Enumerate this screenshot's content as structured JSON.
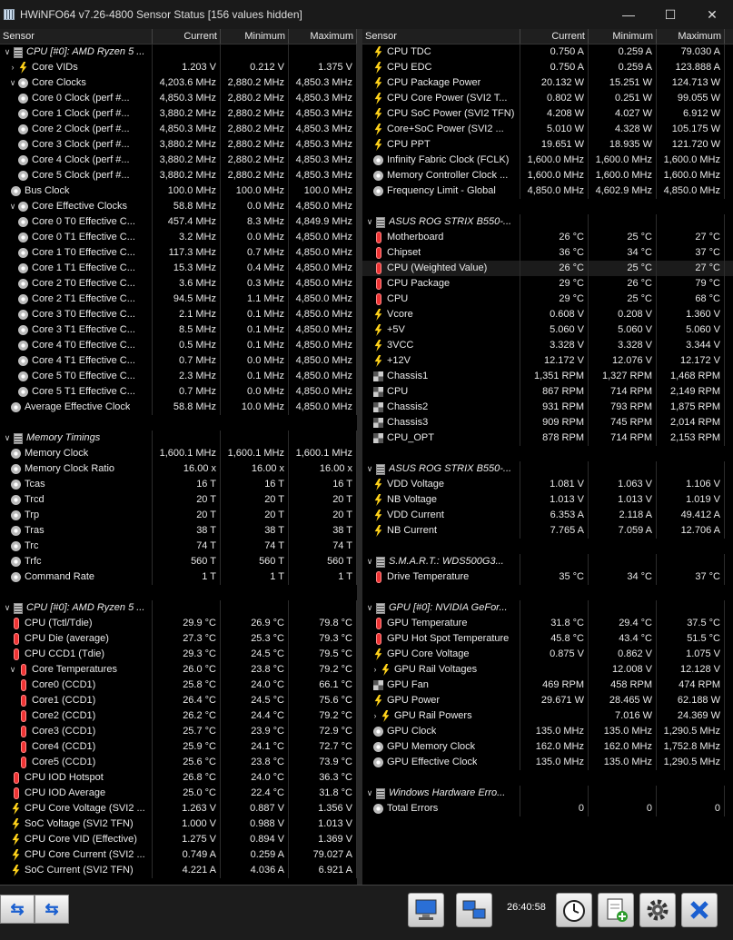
{
  "window": {
    "title": "HWiNFO64 v7.26-4800 Sensor Status [156 values hidden]",
    "min": "—",
    "max": "☐",
    "close": "✕"
  },
  "columns": {
    "sensor": "Sensor",
    "current": "Current",
    "minimum": "Minimum",
    "maximum": "Maximum"
  },
  "left_rows": [
    {
      "t": "grp",
      "exp": "∨",
      "ic": "chip",
      "n": "CPU [#0]: AMD Ryzen 5 ...",
      "c": "",
      "mn": "",
      "mx": ""
    },
    {
      "t": "r",
      "ind": 1,
      "exp": "›",
      "ic": "bolt",
      "n": "Core VIDs",
      "c": "1.203 V",
      "mn": "0.212 V",
      "mx": "1.375 V"
    },
    {
      "t": "r",
      "ind": 1,
      "exp": "∨",
      "ic": "clock",
      "n": "Core Clocks",
      "c": "4,203.6 MHz",
      "mn": "2,880.2 MHz",
      "mx": "4,850.3 MHz"
    },
    {
      "t": "r",
      "ind": 2,
      "ic": "clock",
      "n": "Core 0 Clock (perf #...",
      "c": "4,850.3 MHz",
      "mn": "2,880.2 MHz",
      "mx": "4,850.3 MHz"
    },
    {
      "t": "r",
      "ind": 2,
      "ic": "clock",
      "n": "Core 1 Clock (perf #...",
      "c": "3,880.2 MHz",
      "mn": "2,880.2 MHz",
      "mx": "4,850.3 MHz"
    },
    {
      "t": "r",
      "ind": 2,
      "ic": "clock",
      "n": "Core 2 Clock (perf #...",
      "c": "4,850.3 MHz",
      "mn": "2,880.2 MHz",
      "mx": "4,850.3 MHz"
    },
    {
      "t": "r",
      "ind": 2,
      "ic": "clock",
      "n": "Core 3 Clock (perf #...",
      "c": "3,880.2 MHz",
      "mn": "2,880.2 MHz",
      "mx": "4,850.3 MHz"
    },
    {
      "t": "r",
      "ind": 2,
      "ic": "clock",
      "n": "Core 4 Clock (perf #...",
      "c": "3,880.2 MHz",
      "mn": "2,880.2 MHz",
      "mx": "4,850.3 MHz"
    },
    {
      "t": "r",
      "ind": 2,
      "ic": "clock",
      "n": "Core 5 Clock (perf #...",
      "c": "3,880.2 MHz",
      "mn": "2,880.2 MHz",
      "mx": "4,850.3 MHz"
    },
    {
      "t": "r",
      "ind": 0,
      "ic": "clock",
      "n": "Bus Clock",
      "c": "100.0 MHz",
      "mn": "100.0 MHz",
      "mx": "100.0 MHz"
    },
    {
      "t": "r",
      "ind": 1,
      "exp": "∨",
      "ic": "clock",
      "n": "Core Effective Clocks",
      "c": "58.8 MHz",
      "mn": "0.0 MHz",
      "mx": "4,850.0 MHz"
    },
    {
      "t": "r",
      "ind": 2,
      "ic": "clock",
      "n": "Core 0 T0 Effective C...",
      "c": "457.4 MHz",
      "mn": "8.3 MHz",
      "mx": "4,849.9 MHz"
    },
    {
      "t": "r",
      "ind": 2,
      "ic": "clock",
      "n": "Core 0 T1 Effective C...",
      "c": "3.2 MHz",
      "mn": "0.0 MHz",
      "mx": "4,850.0 MHz"
    },
    {
      "t": "r",
      "ind": 2,
      "ic": "clock",
      "n": "Core 1 T0 Effective C...",
      "c": "117.3 MHz",
      "mn": "0.7 MHz",
      "mx": "4,850.0 MHz"
    },
    {
      "t": "r",
      "ind": 2,
      "ic": "clock",
      "n": "Core 1 T1 Effective C...",
      "c": "15.3 MHz",
      "mn": "0.4 MHz",
      "mx": "4,850.0 MHz"
    },
    {
      "t": "r",
      "ind": 2,
      "ic": "clock",
      "n": "Core 2 T0 Effective C...",
      "c": "3.6 MHz",
      "mn": "0.3 MHz",
      "mx": "4,850.0 MHz"
    },
    {
      "t": "r",
      "ind": 2,
      "ic": "clock",
      "n": "Core 2 T1 Effective C...",
      "c": "94.5 MHz",
      "mn": "1.1 MHz",
      "mx": "4,850.0 MHz"
    },
    {
      "t": "r",
      "ind": 2,
      "ic": "clock",
      "n": "Core 3 T0 Effective C...",
      "c": "2.1 MHz",
      "mn": "0.1 MHz",
      "mx": "4,850.0 MHz"
    },
    {
      "t": "r",
      "ind": 2,
      "ic": "clock",
      "n": "Core 3 T1 Effective C...",
      "c": "8.5 MHz",
      "mn": "0.1 MHz",
      "mx": "4,850.0 MHz"
    },
    {
      "t": "r",
      "ind": 2,
      "ic": "clock",
      "n": "Core 4 T0 Effective C...",
      "c": "0.5 MHz",
      "mn": "0.1 MHz",
      "mx": "4,850.0 MHz"
    },
    {
      "t": "r",
      "ind": 2,
      "ic": "clock",
      "n": "Core 4 T1 Effective C...",
      "c": "0.7 MHz",
      "mn": "0.0 MHz",
      "mx": "4,850.0 MHz"
    },
    {
      "t": "r",
      "ind": 2,
      "ic": "clock",
      "n": "Core 5 T0 Effective C...",
      "c": "2.3 MHz",
      "mn": "0.1 MHz",
      "mx": "4,850.0 MHz"
    },
    {
      "t": "r",
      "ind": 2,
      "ic": "clock",
      "n": "Core 5 T1 Effective C...",
      "c": "0.7 MHz",
      "mn": "0.0 MHz",
      "mx": "4,850.0 MHz"
    },
    {
      "t": "r",
      "ind": 0,
      "ic": "clock",
      "n": "Average Effective Clock",
      "c": "58.8 MHz",
      "mn": "10.0 MHz",
      "mx": "4,850.0 MHz"
    },
    {
      "t": "sep"
    },
    {
      "t": "grp",
      "exp": "∨",
      "ic": "chip",
      "n": "Memory Timings",
      "c": "",
      "mn": "",
      "mx": ""
    },
    {
      "t": "r",
      "ind": 0,
      "ic": "clock",
      "n": "Memory Clock",
      "c": "1,600.1 MHz",
      "mn": "1,600.1 MHz",
      "mx": "1,600.1 MHz"
    },
    {
      "t": "r",
      "ind": 0,
      "ic": "clock",
      "n": "Memory Clock Ratio",
      "c": "16.00 x",
      "mn": "16.00 x",
      "mx": "16.00 x"
    },
    {
      "t": "r",
      "ind": 0,
      "ic": "clock",
      "n": "Tcas",
      "c": "16 T",
      "mn": "16 T",
      "mx": "16 T"
    },
    {
      "t": "r",
      "ind": 0,
      "ic": "clock",
      "n": "Trcd",
      "c": "20 T",
      "mn": "20 T",
      "mx": "20 T"
    },
    {
      "t": "r",
      "ind": 0,
      "ic": "clock",
      "n": "Trp",
      "c": "20 T",
      "mn": "20 T",
      "mx": "20 T"
    },
    {
      "t": "r",
      "ind": 0,
      "ic": "clock",
      "n": "Tras",
      "c": "38 T",
      "mn": "38 T",
      "mx": "38 T"
    },
    {
      "t": "r",
      "ind": 0,
      "ic": "clock",
      "n": "Trc",
      "c": "74 T",
      "mn": "74 T",
      "mx": "74 T"
    },
    {
      "t": "r",
      "ind": 0,
      "ic": "clock",
      "n": "Trfc",
      "c": "560 T",
      "mn": "560 T",
      "mx": "560 T"
    },
    {
      "t": "r",
      "ind": 0,
      "ic": "clock",
      "n": "Command Rate",
      "c": "1 T",
      "mn": "1 T",
      "mx": "1 T"
    },
    {
      "t": "sep"
    },
    {
      "t": "grp",
      "exp": "∨",
      "ic": "chip",
      "n": "CPU [#0]: AMD Ryzen 5 ...",
      "c": "",
      "mn": "",
      "mx": ""
    },
    {
      "t": "r",
      "ind": 0,
      "ic": "therm",
      "n": "CPU (Tctl/Tdie)",
      "c": "29.9 °C",
      "mn": "26.9 °C",
      "mx": "79.8 °C"
    },
    {
      "t": "r",
      "ind": 0,
      "ic": "therm",
      "n": "CPU Die (average)",
      "c": "27.3 °C",
      "mn": "25.3 °C",
      "mx": "79.3 °C"
    },
    {
      "t": "r",
      "ind": 0,
      "ic": "therm",
      "n": "CPU CCD1 (Tdie)",
      "c": "29.3 °C",
      "mn": "24.5 °C",
      "mx": "79.5 °C"
    },
    {
      "t": "r",
      "ind": 1,
      "exp": "∨",
      "ic": "therm",
      "n": "Core Temperatures",
      "c": "26.0 °C",
      "mn": "23.8 °C",
      "mx": "79.2 °C"
    },
    {
      "t": "r",
      "ind": 2,
      "ic": "therm",
      "n": "Core0 (CCD1)",
      "c": "25.8 °C",
      "mn": "24.0 °C",
      "mx": "66.1 °C"
    },
    {
      "t": "r",
      "ind": 2,
      "ic": "therm",
      "n": "Core1 (CCD1)",
      "c": "26.4 °C",
      "mn": "24.5 °C",
      "mx": "75.6 °C"
    },
    {
      "t": "r",
      "ind": 2,
      "ic": "therm",
      "n": "Core2 (CCD1)",
      "c": "26.2 °C",
      "mn": "24.4 °C",
      "mx": "79.2 °C"
    },
    {
      "t": "r",
      "ind": 2,
      "ic": "therm",
      "n": "Core3 (CCD1)",
      "c": "25.7 °C",
      "mn": "23.9 °C",
      "mx": "72.9 °C"
    },
    {
      "t": "r",
      "ind": 2,
      "ic": "therm",
      "n": "Core4 (CCD1)",
      "c": "25.9 °C",
      "mn": "24.1 °C",
      "mx": "72.7 °C"
    },
    {
      "t": "r",
      "ind": 2,
      "ic": "therm",
      "n": "Core5 (CCD1)",
      "c": "25.6 °C",
      "mn": "23.8 °C",
      "mx": "73.9 °C"
    },
    {
      "t": "r",
      "ind": 0,
      "ic": "therm",
      "n": "CPU IOD Hotspot",
      "c": "26.8 °C",
      "mn": "24.0 °C",
      "mx": "36.3 °C"
    },
    {
      "t": "r",
      "ind": 0,
      "ic": "therm",
      "n": "CPU IOD Average",
      "c": "25.0 °C",
      "mn": "22.4 °C",
      "mx": "31.8 °C"
    },
    {
      "t": "r",
      "ind": 0,
      "ic": "bolt",
      "n": "CPU Core Voltage (SVI2 ...",
      "c": "1.263 V",
      "mn": "0.887 V",
      "mx": "1.356 V"
    },
    {
      "t": "r",
      "ind": 0,
      "ic": "bolt",
      "n": "SoC Voltage (SVI2 TFN)",
      "c": "1.000 V",
      "mn": "0.988 V",
      "mx": "1.013 V"
    },
    {
      "t": "r",
      "ind": 0,
      "ic": "bolt",
      "n": "CPU Core VID (Effective)",
      "c": "1.275 V",
      "mn": "0.894 V",
      "mx": "1.369 V"
    },
    {
      "t": "r",
      "ind": 0,
      "ic": "bolt",
      "n": "CPU Core Current (SVI2 ...",
      "c": "0.749 A",
      "mn": "0.259 A",
      "mx": "79.027 A"
    },
    {
      "t": "r",
      "ind": 0,
      "ic": "bolt",
      "n": "SoC Current (SVI2 TFN)",
      "c": "4.221 A",
      "mn": "4.036 A",
      "mx": "6.921 A"
    }
  ],
  "right_rows": [
    {
      "t": "r",
      "ind": 0,
      "ic": "bolt",
      "n": "CPU TDC",
      "c": "0.750 A",
      "mn": "0.259 A",
      "mx": "79.030 A"
    },
    {
      "t": "r",
      "ind": 0,
      "ic": "bolt",
      "n": "CPU EDC",
      "c": "0.750 A",
      "mn": "0.259 A",
      "mx": "123.888 A"
    },
    {
      "t": "r",
      "ind": 0,
      "ic": "bolt",
      "n": "CPU Package Power",
      "c": "20.132 W",
      "mn": "15.251 W",
      "mx": "124.713 W"
    },
    {
      "t": "r",
      "ind": 0,
      "ic": "bolt",
      "n": "CPU Core Power (SVI2 T...",
      "c": "0.802 W",
      "mn": "0.251 W",
      "mx": "99.055 W"
    },
    {
      "t": "r",
      "ind": 0,
      "ic": "bolt",
      "n": "CPU SoC Power (SVI2 TFN)",
      "c": "4.208 W",
      "mn": "4.027 W",
      "mx": "6.912 W"
    },
    {
      "t": "r",
      "ind": 0,
      "ic": "bolt",
      "n": "Core+SoC Power (SVI2 ...",
      "c": "5.010 W",
      "mn": "4.328 W",
      "mx": "105.175 W"
    },
    {
      "t": "r",
      "ind": 0,
      "ic": "bolt",
      "n": "CPU PPT",
      "c": "19.651 W",
      "mn": "18.935 W",
      "mx": "121.720 W"
    },
    {
      "t": "r",
      "ind": 0,
      "ic": "clock",
      "n": "Infinity Fabric Clock (FCLK)",
      "c": "1,600.0 MHz",
      "mn": "1,600.0 MHz",
      "mx": "1,600.0 MHz"
    },
    {
      "t": "r",
      "ind": 0,
      "ic": "clock",
      "n": "Memory Controller Clock ...",
      "c": "1,600.0 MHz",
      "mn": "1,600.0 MHz",
      "mx": "1,600.0 MHz"
    },
    {
      "t": "r",
      "ind": 0,
      "ic": "clock",
      "n": "Frequency Limit - Global",
      "c": "4,850.0 MHz",
      "mn": "4,602.9 MHz",
      "mx": "4,850.0 MHz"
    },
    {
      "t": "sep"
    },
    {
      "t": "grp",
      "exp": "∨",
      "ic": "chip",
      "n": "ASUS ROG STRIX B550-...",
      "c": "",
      "mn": "",
      "mx": ""
    },
    {
      "t": "r",
      "ind": 0,
      "ic": "therm",
      "n": "Motherboard",
      "c": "26 °C",
      "mn": "25 °C",
      "mx": "27 °C"
    },
    {
      "t": "r",
      "ind": 0,
      "ic": "therm",
      "n": "Chipset",
      "c": "36 °C",
      "mn": "34 °C",
      "mx": "37 °C"
    },
    {
      "t": "r",
      "ind": 0,
      "ic": "therm",
      "n": "CPU (Weighted Value)",
      "c": "26 °C",
      "mn": "25 °C",
      "mx": "27 °C",
      "hl": true
    },
    {
      "t": "r",
      "ind": 0,
      "ic": "therm",
      "n": "CPU Package",
      "c": "29 °C",
      "mn": "26 °C",
      "mx": "79 °C"
    },
    {
      "t": "r",
      "ind": 0,
      "ic": "therm",
      "n": "CPU",
      "c": "29 °C",
      "mn": "25 °C",
      "mx": "68 °C"
    },
    {
      "t": "r",
      "ind": 0,
      "ic": "bolt",
      "n": "Vcore",
      "c": "0.608 V",
      "mn": "0.208 V",
      "mx": "1.360 V"
    },
    {
      "t": "r",
      "ind": 0,
      "ic": "bolt",
      "n": "+5V",
      "c": "5.060 V",
      "mn": "5.060 V",
      "mx": "5.060 V"
    },
    {
      "t": "r",
      "ind": 0,
      "ic": "bolt",
      "n": "3VCC",
      "c": "3.328 V",
      "mn": "3.328 V",
      "mx": "3.344 V"
    },
    {
      "t": "r",
      "ind": 0,
      "ic": "bolt",
      "n": "+12V",
      "c": "12.172 V",
      "mn": "12.076 V",
      "mx": "12.172 V"
    },
    {
      "t": "r",
      "ind": 0,
      "ic": "fan",
      "n": "Chassis1",
      "c": "1,351 RPM",
      "mn": "1,327 RPM",
      "mx": "1,468 RPM"
    },
    {
      "t": "r",
      "ind": 0,
      "ic": "fan",
      "n": "CPU",
      "c": "867 RPM",
      "mn": "714 RPM",
      "mx": "2,149 RPM"
    },
    {
      "t": "r",
      "ind": 0,
      "ic": "fan",
      "n": "Chassis2",
      "c": "931 RPM",
      "mn": "793 RPM",
      "mx": "1,875 RPM"
    },
    {
      "t": "r",
      "ind": 0,
      "ic": "fan",
      "n": "Chassis3",
      "c": "909 RPM",
      "mn": "745 RPM",
      "mx": "2,014 RPM"
    },
    {
      "t": "r",
      "ind": 0,
      "ic": "fan",
      "n": "CPU_OPT",
      "c": "878 RPM",
      "mn": "714 RPM",
      "mx": "2,153 RPM"
    },
    {
      "t": "sep"
    },
    {
      "t": "grp",
      "exp": "∨",
      "ic": "chip",
      "n": "ASUS ROG STRIX B550-...",
      "c": "",
      "mn": "",
      "mx": ""
    },
    {
      "t": "r",
      "ind": 0,
      "ic": "bolt",
      "n": "VDD Voltage",
      "c": "1.081 V",
      "mn": "1.063 V",
      "mx": "1.106 V"
    },
    {
      "t": "r",
      "ind": 0,
      "ic": "bolt",
      "n": "NB Voltage",
      "c": "1.013 V",
      "mn": "1.013 V",
      "mx": "1.019 V"
    },
    {
      "t": "r",
      "ind": 0,
      "ic": "bolt",
      "n": "VDD Current",
      "c": "6.353 A",
      "mn": "2.118 A",
      "mx": "49.412 A"
    },
    {
      "t": "r",
      "ind": 0,
      "ic": "bolt",
      "n": "NB Current",
      "c": "7.765 A",
      "mn": "7.059 A",
      "mx": "12.706 A"
    },
    {
      "t": "sep"
    },
    {
      "t": "grp",
      "exp": "∨",
      "ic": "chip",
      "n": "S.M.A.R.T.: WDS500G3...",
      "c": "",
      "mn": "",
      "mx": ""
    },
    {
      "t": "r",
      "ind": 0,
      "ic": "therm",
      "n": "Drive Temperature",
      "c": "35 °C",
      "mn": "34 °C",
      "mx": "37 °C"
    },
    {
      "t": "sep"
    },
    {
      "t": "grp",
      "exp": "∨",
      "ic": "chip",
      "n": "GPU [#0]: NVIDIA GeFor...",
      "c": "",
      "mn": "",
      "mx": ""
    },
    {
      "t": "r",
      "ind": 0,
      "ic": "therm",
      "n": "GPU Temperature",
      "c": "31.8 °C",
      "mn": "29.4 °C",
      "mx": "37.5 °C"
    },
    {
      "t": "r",
      "ind": 0,
      "ic": "therm",
      "n": "GPU Hot Spot Temperature",
      "c": "45.8 °C",
      "mn": "43.4 °C",
      "mx": "51.5 °C"
    },
    {
      "t": "r",
      "ind": 0,
      "ic": "bolt",
      "n": "GPU Core Voltage",
      "c": "0.875 V",
      "mn": "0.862 V",
      "mx": "1.075 V"
    },
    {
      "t": "r",
      "ind": 1,
      "exp": "›",
      "ic": "bolt",
      "n": "GPU Rail Voltages",
      "c": "",
      "mn": "12.008 V",
      "mx": "12.128 V"
    },
    {
      "t": "r",
      "ind": 0,
      "ic": "fan",
      "n": "GPU Fan",
      "c": "469 RPM",
      "mn": "458 RPM",
      "mx": "474 RPM"
    },
    {
      "t": "r",
      "ind": 0,
      "ic": "bolt",
      "n": "GPU Power",
      "c": "29.671 W",
      "mn": "28.465 W",
      "mx": "62.188 W"
    },
    {
      "t": "r",
      "ind": 1,
      "exp": "›",
      "ic": "bolt",
      "n": "GPU Rail Powers",
      "c": "",
      "mn": "7.016 W",
      "mx": "24.369 W"
    },
    {
      "t": "r",
      "ind": 0,
      "ic": "clock",
      "n": "GPU Clock",
      "c": "135.0 MHz",
      "mn": "135.0 MHz",
      "mx": "1,290.5 MHz"
    },
    {
      "t": "r",
      "ind": 0,
      "ic": "clock",
      "n": "GPU Memory Clock",
      "c": "162.0 MHz",
      "mn": "162.0 MHz",
      "mx": "1,752.8 MHz"
    },
    {
      "t": "r",
      "ind": 0,
      "ic": "clock",
      "n": "GPU Effective Clock",
      "c": "135.0 MHz",
      "mn": "135.0 MHz",
      "mx": "1,290.5 MHz"
    },
    {
      "t": "sep"
    },
    {
      "t": "grp",
      "exp": "∨",
      "ic": "chip",
      "n": "Windows Hardware Erro...",
      "c": "",
      "mn": "",
      "mx": ""
    },
    {
      "t": "r",
      "ind": 0,
      "ic": "clock",
      "n": "Total Errors",
      "c": "0",
      "mn": "0",
      "mx": "0"
    }
  ],
  "statusbar": {
    "time": "26:40:58",
    "nav_left": "⇆",
    "nav_right": "⇆"
  }
}
